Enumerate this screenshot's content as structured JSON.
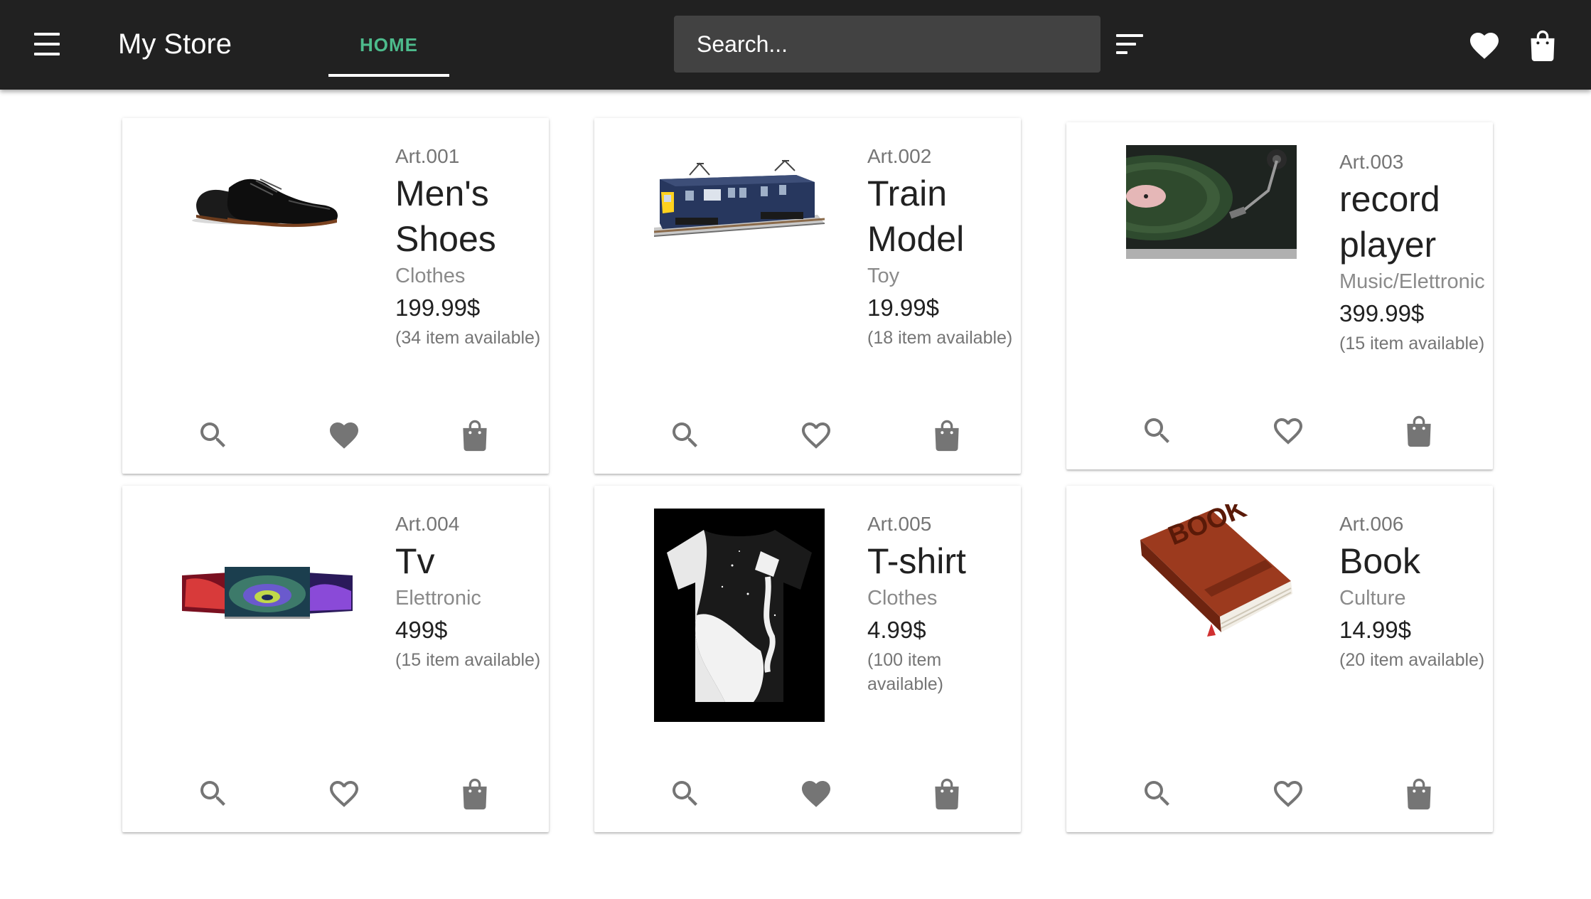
{
  "toolbar": {
    "title": "My Store",
    "tab_home": "HOME",
    "search_placeholder": "Search...",
    "menu_icon": "menu-icon",
    "filter_icon": "sort-icon",
    "favorites_icon": "heart-icon",
    "cart_icon": "shopping-bag-icon",
    "colors": {
      "bar": "#212121",
      "accent": "#4dbb8c",
      "search_bg": "#424242"
    }
  },
  "products": [
    {
      "art": "Art.001",
      "name": "Men's Shoes",
      "category": "Clothes",
      "price": "199.99$",
      "availability": "(34 item available)",
      "favorite": true,
      "image": "black oxford shoes"
    },
    {
      "art": "Art.002",
      "name": "Train Model",
      "category": "Toy",
      "price": "19.99$",
      "availability": "(18 item available)",
      "favorite": false,
      "image": "blue electric train model"
    },
    {
      "art": "Art.003",
      "name": "record player",
      "category": "Music/Elettronic",
      "price": "399.99$",
      "availability": "(15 item available)",
      "favorite": false,
      "image": "vinyl record on turntable"
    },
    {
      "art": "Art.004",
      "name": "Tv",
      "category": "Elettronic",
      "price": "499$",
      "availability": "(15 item available)",
      "favorite": false,
      "image": "three tv screens"
    },
    {
      "art": "Art.005",
      "name": "T-shirt",
      "category": "Clothes",
      "price": "4.99$",
      "availability": "(100 item available)",
      "favorite": true,
      "image": "black and white paint t-shirt"
    },
    {
      "art": "Art.006",
      "name": "Book",
      "category": "Culture",
      "price": "14.99$",
      "availability": "(20 item available)",
      "favorite": false,
      "image": "brown book icon",
      "cover_text": "BOOK"
    }
  ],
  "card_actions": {
    "view_icon": "search-icon",
    "favorite_icon": "heart-icon",
    "cart_icon": "shopping-bag-icon",
    "icon_color": "#757575"
  }
}
